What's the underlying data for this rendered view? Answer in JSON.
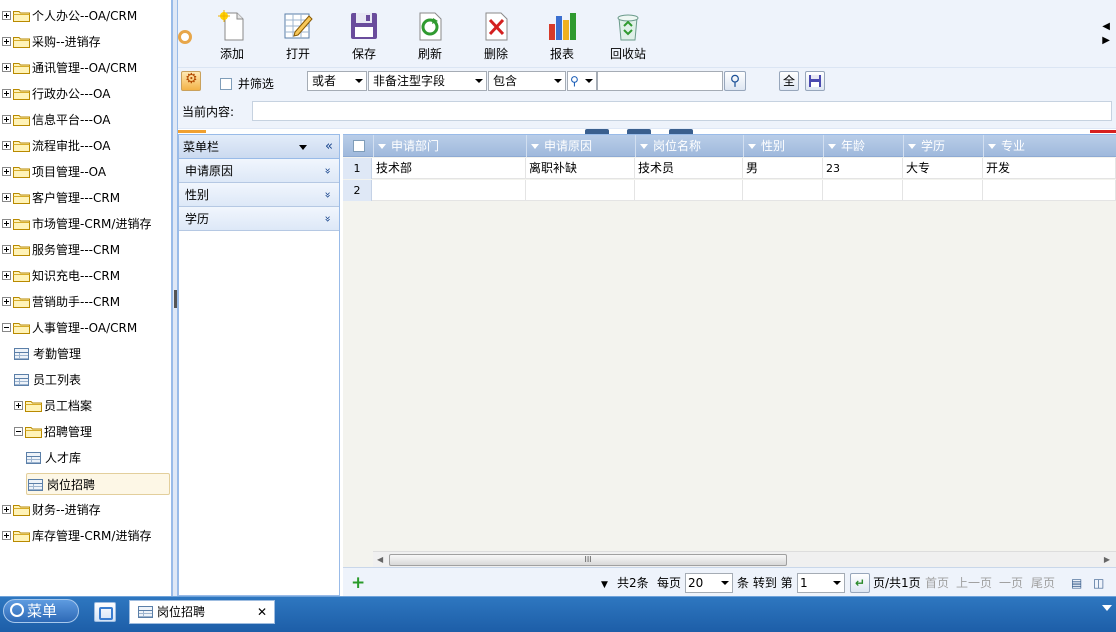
{
  "tree": [
    {
      "label": "个人办公--OA/CRM",
      "type": "folder",
      "state": "collapsed"
    },
    {
      "label": "采购--进销存",
      "type": "folder",
      "state": "collapsed"
    },
    {
      "label": "通讯管理--OA/CRM",
      "type": "folder",
      "state": "collapsed"
    },
    {
      "label": "行政办公---OA",
      "type": "folder",
      "state": "collapsed"
    },
    {
      "label": "信息平台---OA",
      "type": "folder",
      "state": "collapsed"
    },
    {
      "label": "流程审批---OA",
      "type": "folder",
      "state": "collapsed"
    },
    {
      "label": "项目管理--OA",
      "type": "folder",
      "state": "collapsed"
    },
    {
      "label": "客户管理---CRM",
      "type": "folder",
      "state": "collapsed"
    },
    {
      "label": "市场管理-CRM/进销存",
      "type": "folder",
      "state": "collapsed"
    },
    {
      "label": "服务管理---CRM",
      "type": "folder",
      "state": "collapsed"
    },
    {
      "label": "知识充电---CRM",
      "type": "folder",
      "state": "collapsed"
    },
    {
      "label": "营销助手---CRM",
      "type": "folder",
      "state": "collapsed"
    },
    {
      "label": "人事管理--OA/CRM",
      "type": "folder",
      "state": "expanded"
    },
    {
      "label": "考勤管理",
      "type": "page"
    },
    {
      "label": "员工列表",
      "type": "page"
    },
    {
      "label": "员工档案",
      "type": "folder",
      "state": "collapsed"
    },
    {
      "label": "招聘管理",
      "type": "folder",
      "state": "expanded"
    },
    {
      "label": "人才库",
      "type": "page"
    },
    {
      "label": "岗位招聘",
      "type": "page",
      "selected": true
    },
    {
      "label": "财务--进销存",
      "type": "folder",
      "state": "collapsed"
    },
    {
      "label": "库存管理-CRM/进销存",
      "type": "folder",
      "state": "collapsed"
    }
  ],
  "toolbar": {
    "add": "添加",
    "open": "打开",
    "save": "保存",
    "refresh": "刷新",
    "delete": "删除",
    "report": "报表",
    "recycle": "回收站"
  },
  "filter": {
    "and_filter": "并筛选",
    "logic": "或者",
    "field": "非备注型字段",
    "op": "包含",
    "search_value": "",
    "all_btn": "全"
  },
  "current": {
    "label": "当前内容:",
    "value": ""
  },
  "accordion": {
    "title": "菜单栏",
    "collapse": "«",
    "items": [
      {
        "label": "申请原因",
        "expand": "»"
      },
      {
        "label": "性别",
        "expand": "»"
      },
      {
        "label": "学历",
        "expand": "»"
      }
    ]
  },
  "grid": {
    "columns": [
      "申请部门",
      "申请原因",
      "岗位名称",
      "性别",
      "年龄",
      "学历",
      "专业"
    ],
    "rows": [
      {
        "num": "1",
        "cells": [
          "技术部",
          "离职补缺",
          "技术员",
          "男",
          "23",
          "大专",
          "开发"
        ]
      },
      {
        "num": "2",
        "cells": [
          "",
          "",
          "",
          "",
          "",
          "",
          ""
        ]
      }
    ]
  },
  "pager": {
    "total": "共2条",
    "per_page_label": "每页",
    "per_page": "20",
    "goto_label": "条 转到 第",
    "page": "1",
    "page_info": "页/共1页",
    "first": "首页",
    "prev": "上一页",
    "next": "一页",
    "last": "尾页"
  },
  "taskbar": {
    "start": "菜单",
    "tab": "岗位招聘",
    "close": "✕"
  }
}
